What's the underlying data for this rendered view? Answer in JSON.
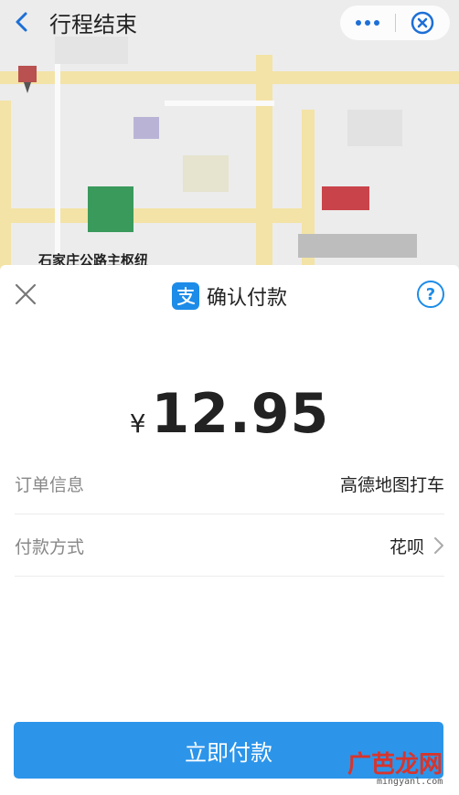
{
  "header": {
    "title": "行程结束",
    "icons": [
      "back-arrow-icon",
      "more-dots-icon",
      "close-target-icon"
    ]
  },
  "map": {
    "location_label": "石家庄公路主枢纽"
  },
  "sheet": {
    "title": "确认付款",
    "help_label": "?",
    "currency_symbol": "¥",
    "amount": "12.95",
    "order_info_label": "订单信息",
    "order_info_value": "高德地图打车",
    "payment_method_label": "付款方式",
    "payment_method_value": "花呗",
    "pay_button_label": "立即付款"
  },
  "watermark": {
    "text": "广芭龙网",
    "url": "mingyanl.com"
  },
  "colors": {
    "accent": "#2c95ea",
    "alipay_blue": "#1d8ce8",
    "map_road": "#f3e3a6"
  }
}
